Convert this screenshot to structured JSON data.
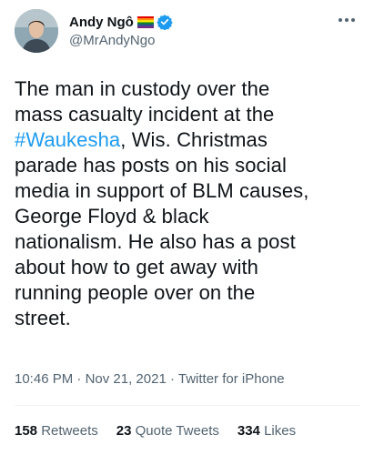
{
  "author": {
    "display_name": "Andy Ngô",
    "handle": "@MrAndyNgo",
    "avatar_icon": "person-avatar",
    "flag_icon": "rainbow-flag-icon",
    "verified_icon": "verified-badge-icon",
    "verified_color": "#1d9bf0"
  },
  "tweet": {
    "lines": [
      [
        "The man in custody over the"
      ],
      [
        "mass casualty incident at the"
      ],
      [
        "#Waukesha",
        ", Wis. Christmas"
      ],
      [
        "parade has posts on his social"
      ],
      [
        "media in support of BLM causes,"
      ],
      [
        "George Floyd & black"
      ],
      [
        "nationalism. He also has a post"
      ],
      [
        "about how to get away with"
      ],
      [
        "running people over on the"
      ],
      [
        "street."
      ]
    ],
    "hashtag_color": "#1d9bf0",
    "time": "10:46 PM",
    "separator": " · ",
    "date": "Nov 21, 2021",
    "source": "Twitter for iPhone"
  },
  "stats": {
    "retweets_count": "158",
    "retweets_label": "Retweets",
    "quotes_count": "23",
    "quotes_label": "Quote Tweets",
    "likes_count": "334",
    "likes_label": "Likes"
  },
  "menu_icon": "more-options-icon"
}
